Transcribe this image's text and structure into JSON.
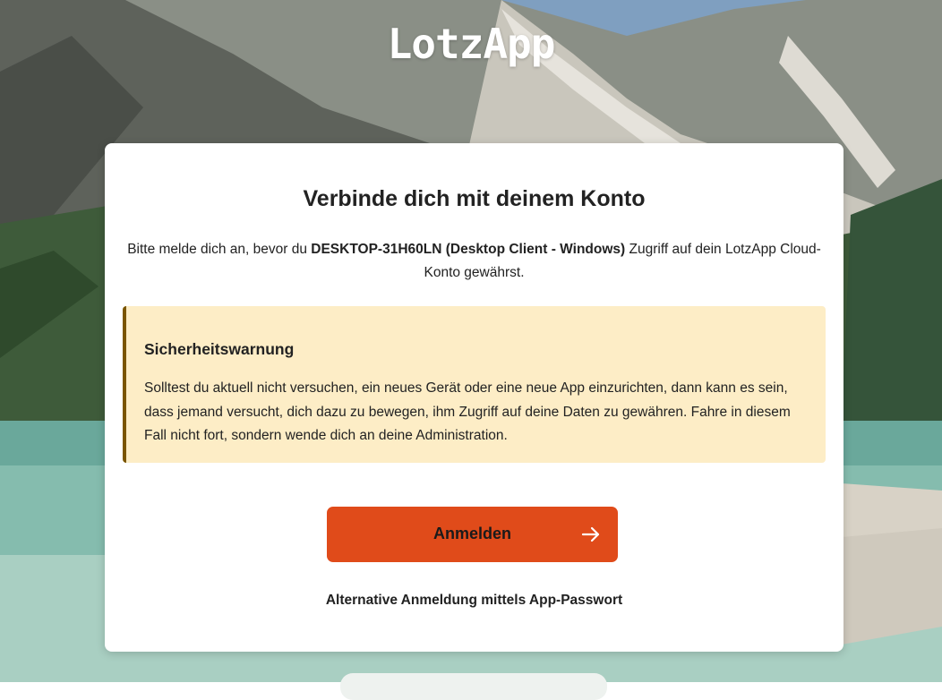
{
  "app": {
    "logo_text": "LotzApp"
  },
  "card": {
    "title": "Verbinde dich mit deinem Konto",
    "intro_before": "Bitte melde dich an, bevor du ",
    "intro_device": "DESKTOP-31H60LN (Desktop Client - Windows)",
    "intro_after": " Zugriff auf dein LotzApp Cloud-Konto gewährst."
  },
  "warning": {
    "title": "Sicherheitswarnung",
    "text": "Solltest du aktuell nicht versuchen, ein neues Gerät oder eine neue App einzurichten, dann kann es sein, dass jemand versucht, dich dazu zu bewegen, ihm Zugriff auf deine Daten zu gewähren. Fahre in diesem Fall nicht fort, sondern wende dich an deine Administration."
  },
  "actions": {
    "login_label": "Anmelden",
    "alt_login_label": "Alternative Anmeldung mittels App-Passwort"
  },
  "icons": {
    "login_arrow": "arrow-right-icon"
  },
  "colors": {
    "primary_button": "#e04b1a",
    "warning_bg": "#fdedc6",
    "warning_border": "#7a5500"
  }
}
